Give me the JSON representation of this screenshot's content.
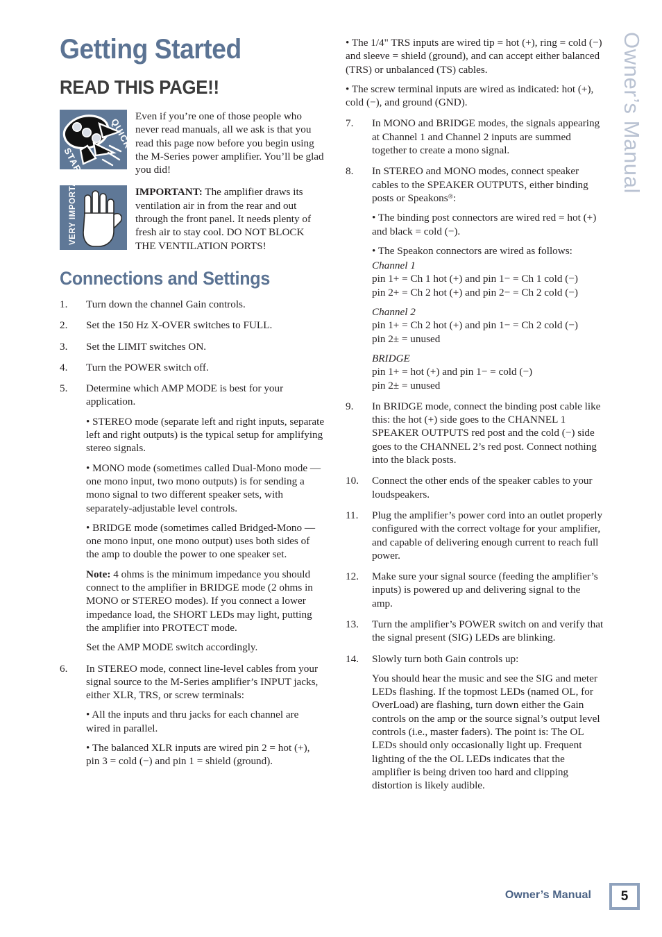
{
  "side_tab": {
    "text": "Owner’s Manual"
  },
  "left_column": {
    "title": "Getting Started",
    "subtitle": "READ THIS PAGE!!",
    "callouts": [
      {
        "icon": "rocket-quick-start-icon",
        "icon_labels": {
          "top": "QUICK",
          "bottom": "START"
        },
        "text": "Even if you’re one of those people who never read manuals, all we ask is that you read this page now before you begin using the M-Series power amplifier. You’ll be glad you did!"
      },
      {
        "icon": "hand-very-important-icon",
        "icon_labels": {
          "side": "VERY IMPORTANT"
        },
        "lead": "IMPORTANT:",
        "text": " The amplifier draws its ventilation air in from the rear and out through the front panel. It needs plenty of fresh air to stay cool. DO NOT BLOCK THE VENTILATION PORTS!"
      }
    ],
    "section_title": "Connections and Settings",
    "steps": [
      {
        "num": "1.",
        "text": "Turn down the channel Gain controls."
      },
      {
        "num": "2.",
        "text": "Set the 150 Hz X-OVER switches to FULL."
      },
      {
        "num": "3.",
        "text": "Set the LIMIT switches ON."
      },
      {
        "num": "4.",
        "text": "Turn the POWER switch off."
      },
      {
        "num": "5.",
        "text": "Determine which AMP MODE is best for your application.",
        "subs": [
          {
            "kind": "bullet",
            "text": "• STEREO mode (separate left and right inputs, separate left and right outputs) is the typical setup for amplifying stereo signals."
          },
          {
            "kind": "bullet",
            "text": "• MONO mode (sometimes called Dual-Mono mode — one mono input, two mono outputs) is for sending a mono signal to two different speaker sets, with separately-adjustable level controls."
          },
          {
            "kind": "bullet",
            "text": "• BRIDGE mode (sometimes called Bridged-Mono — one mono input, one mono output) uses both sides of the amp to double the power to one speaker set."
          },
          {
            "kind": "note",
            "lead": "Note:",
            "text": " 4 ohms is the minimum impedance you should connect to the amplifier in BRIDGE mode (2 ohms in MONO or STEREO modes). If you connect a lower impedance load, the SHORT LEDs may light, putting the amplifier into PROTECT mode."
          },
          {
            "kind": "plain",
            "text": "Set the AMP MODE switch accordingly."
          }
        ]
      },
      {
        "num": "6.",
        "text": "In STEREO mode, connect line-level cables from your signal source to the M-Series amplifier’s INPUT jacks, either XLR, TRS, or screw terminals:",
        "subs": [
          {
            "kind": "bullet",
            "text": "• All the inputs and thru jacks for each channel are wired in parallel."
          },
          {
            "kind": "bullet",
            "text": "• The balanced XLR inputs are wired pin 2 = hot (+), pin 3 = cold (−) and pin 1 = shield (ground)."
          }
        ]
      }
    ]
  },
  "right_column": {
    "lead_bullets": [
      "• The 1/4\" TRS inputs are wired tip = hot (+), ring = cold (−) and sleeve = shield (ground), and can accept either balanced (TRS) or unbalanced (TS) cables.",
      "• The screw terminal inputs are wired as indicated: hot (+), cold (−), and ground (GND)."
    ],
    "steps": [
      {
        "num": "7.",
        "text": "In MONO and BRIDGE modes, the signals appearing at Channel 1 and Channel 2 inputs are summed together to create a mono signal."
      },
      {
        "num": "8.",
        "text_pre": "In STEREO and MONO modes, connect speaker cables to the SPEAKER OUTPUTS, either binding posts or Speakons",
        "text_post": ":",
        "registered": "®",
        "subs": [
          {
            "kind": "bullet",
            "text": "• The binding post connectors are wired red = hot (+) and black = cold (−)."
          },
          {
            "kind": "bullet",
            "text": "• The Speakon connectors are wired as follows:"
          }
        ],
        "pin_groups": [
          {
            "heading": "Channel 1",
            "lines": [
              "pin 1+ = Ch 1 hot (+) and pin 1− =  Ch 1 cold (−)",
              "pin 2+ = Ch 2 hot (+) and pin 2− =  Ch 2 cold (−)"
            ]
          },
          {
            "heading": "Channel 2",
            "lines": [
              "pin 1+ = Ch 2 hot (+) and pin 1− =  Ch 2 cold (−)",
              "pin 2± = unused"
            ]
          },
          {
            "heading": "BRIDGE",
            "lines": [
              "pin 1+ = hot (+) and pin 1− = cold (−)",
              "pin 2± = unused"
            ]
          }
        ]
      },
      {
        "num": "9.",
        "text": "In BRIDGE mode, connect the binding post cable like this: the hot (+) side goes to the CHANNEL 1 SPEAKER OUTPUTS red post and the cold (−) side goes to the CHANNEL 2’s red post. Connect nothing into the black posts."
      },
      {
        "num": "10.",
        "text": "Connect the other ends of the speaker cables to your loudspeakers."
      },
      {
        "num": "11.",
        "text": "Plug the amplifier’s power cord into an outlet properly configured with the correct voltage for your amplifier, and capable of delivering enough current to reach full power."
      },
      {
        "num": "12.",
        "text": "Make sure your signal source (feeding the amplifier’s inputs) is powered up and delivering signal to the amp."
      },
      {
        "num": "13.",
        "text": "Turn the amplifier’s POWER switch on and verify that the signal present (SIG) LEDs are blinking."
      },
      {
        "num": "14.",
        "text": "Slowly turn both Gain controls up:",
        "subs": [
          {
            "kind": "plain",
            "text": "You should hear the music and see the SIG and meter LEDs flashing. If the topmost LEDs (named OL, for OverLoad) are flashing, turn down either the Gain controls on the amp or the source signal’s output level controls (i.e., master faders). The point is: The OL LEDs should only occasionally light up. Frequent lighting of the the OL LEDs indicates that the amplifier is being driven too hard and clipping distortion is likely audible."
          }
        ]
      }
    ]
  },
  "footer": {
    "label": "Owner’s Manual",
    "page_number": "5"
  },
  "colors": {
    "heading_blue": "#5b7393",
    "subtitle_gray": "#3b3b3b",
    "icon_bg": "#5f7897",
    "side_tab": "#b9c2d2",
    "footer_blue": "#4a6285",
    "page_box_border": "#8fa2bd"
  }
}
